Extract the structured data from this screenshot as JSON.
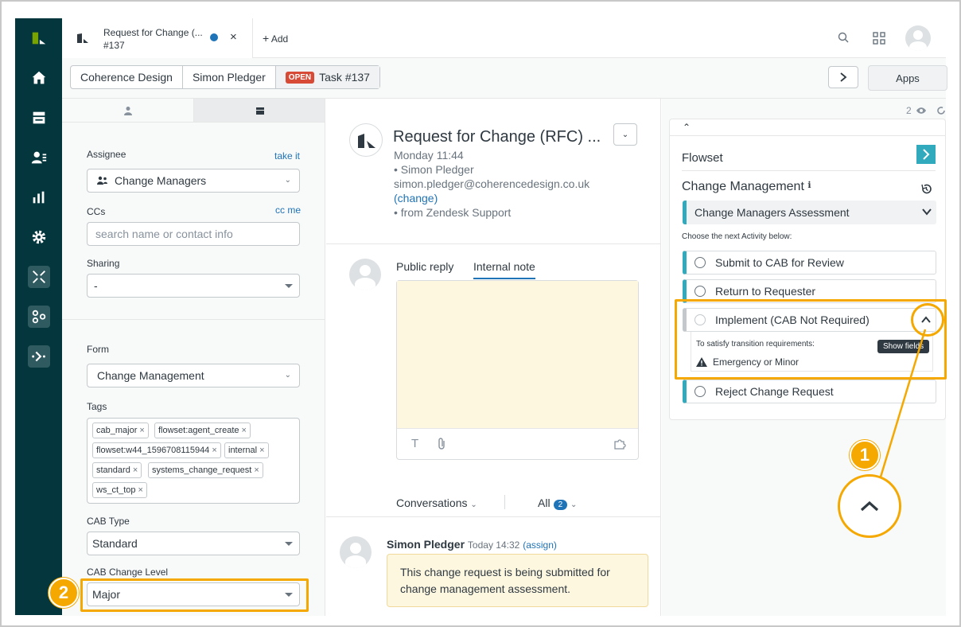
{
  "tab": {
    "title": "Request for Change (...",
    "subtitle": "#137",
    "close": "×",
    "add_label": "Add"
  },
  "breadcrumbs": {
    "org": "Coherence Design",
    "requester": "Simon Pledger",
    "status": "OPEN",
    "ticket": "Task #137"
  },
  "apps_label": "Apps",
  "props": {
    "assignee_label": "Assignee",
    "take_it": "take it",
    "assignee_value": "Change Managers",
    "ccs_label": "CCs",
    "cc_me": "cc me",
    "ccs_placeholder": "search name or contact info",
    "sharing_label": "Sharing",
    "sharing_value": "-",
    "form_label": "Form",
    "form_value": "Change Management",
    "tags_label": "Tags",
    "tags": [
      "cab_major",
      "flowset:agent_create",
      "flowset:w44_1596708115944",
      "internal",
      "standard",
      "systems_change_request",
      "ws_ct_top"
    ],
    "cab_type_label": "CAB Type",
    "cab_type_value": "Standard",
    "cab_level_label": "CAB Change Level",
    "cab_level_value": "Major"
  },
  "ticket": {
    "subject": "Request for Change (RFC) ...",
    "time": "Monday 11:44",
    "requester": "• Simon Pledger",
    "email": "simon.pledger@coherencedesign.co.uk",
    "change": "(change)",
    "via": "• from Zendesk Support"
  },
  "composer": {
    "public_reply": "Public reply",
    "internal_note": "Internal note"
  },
  "conversations": {
    "label": "Conversations",
    "all": "All",
    "count": "2"
  },
  "message": {
    "author": "Simon Pledger",
    "time": "Today 14:32",
    "assign": "(assign)",
    "text": "This change request is being submitted for change management assessment."
  },
  "flowset": {
    "viewer_count": "2",
    "title": "Flowset",
    "process": "Change Management",
    "current": "Change Managers Assessment",
    "choose": "Choose the next Activity below:",
    "activities": [
      "Submit to CAB for Review",
      "Return to Requester",
      "Implement (CAB Not Required)",
      "Reject Change Request"
    ],
    "requirement_intro": "To satisfy transition requirements:",
    "requirement": "Emergency or Minor",
    "tooltip": "Show fields"
  },
  "callouts": [
    "1",
    "2"
  ],
  "colors": {
    "nav": "#03363d",
    "accent": "#1f73b7",
    "flow": "#30aabc",
    "highlight": "#f4a800",
    "open": "#d74a35"
  }
}
